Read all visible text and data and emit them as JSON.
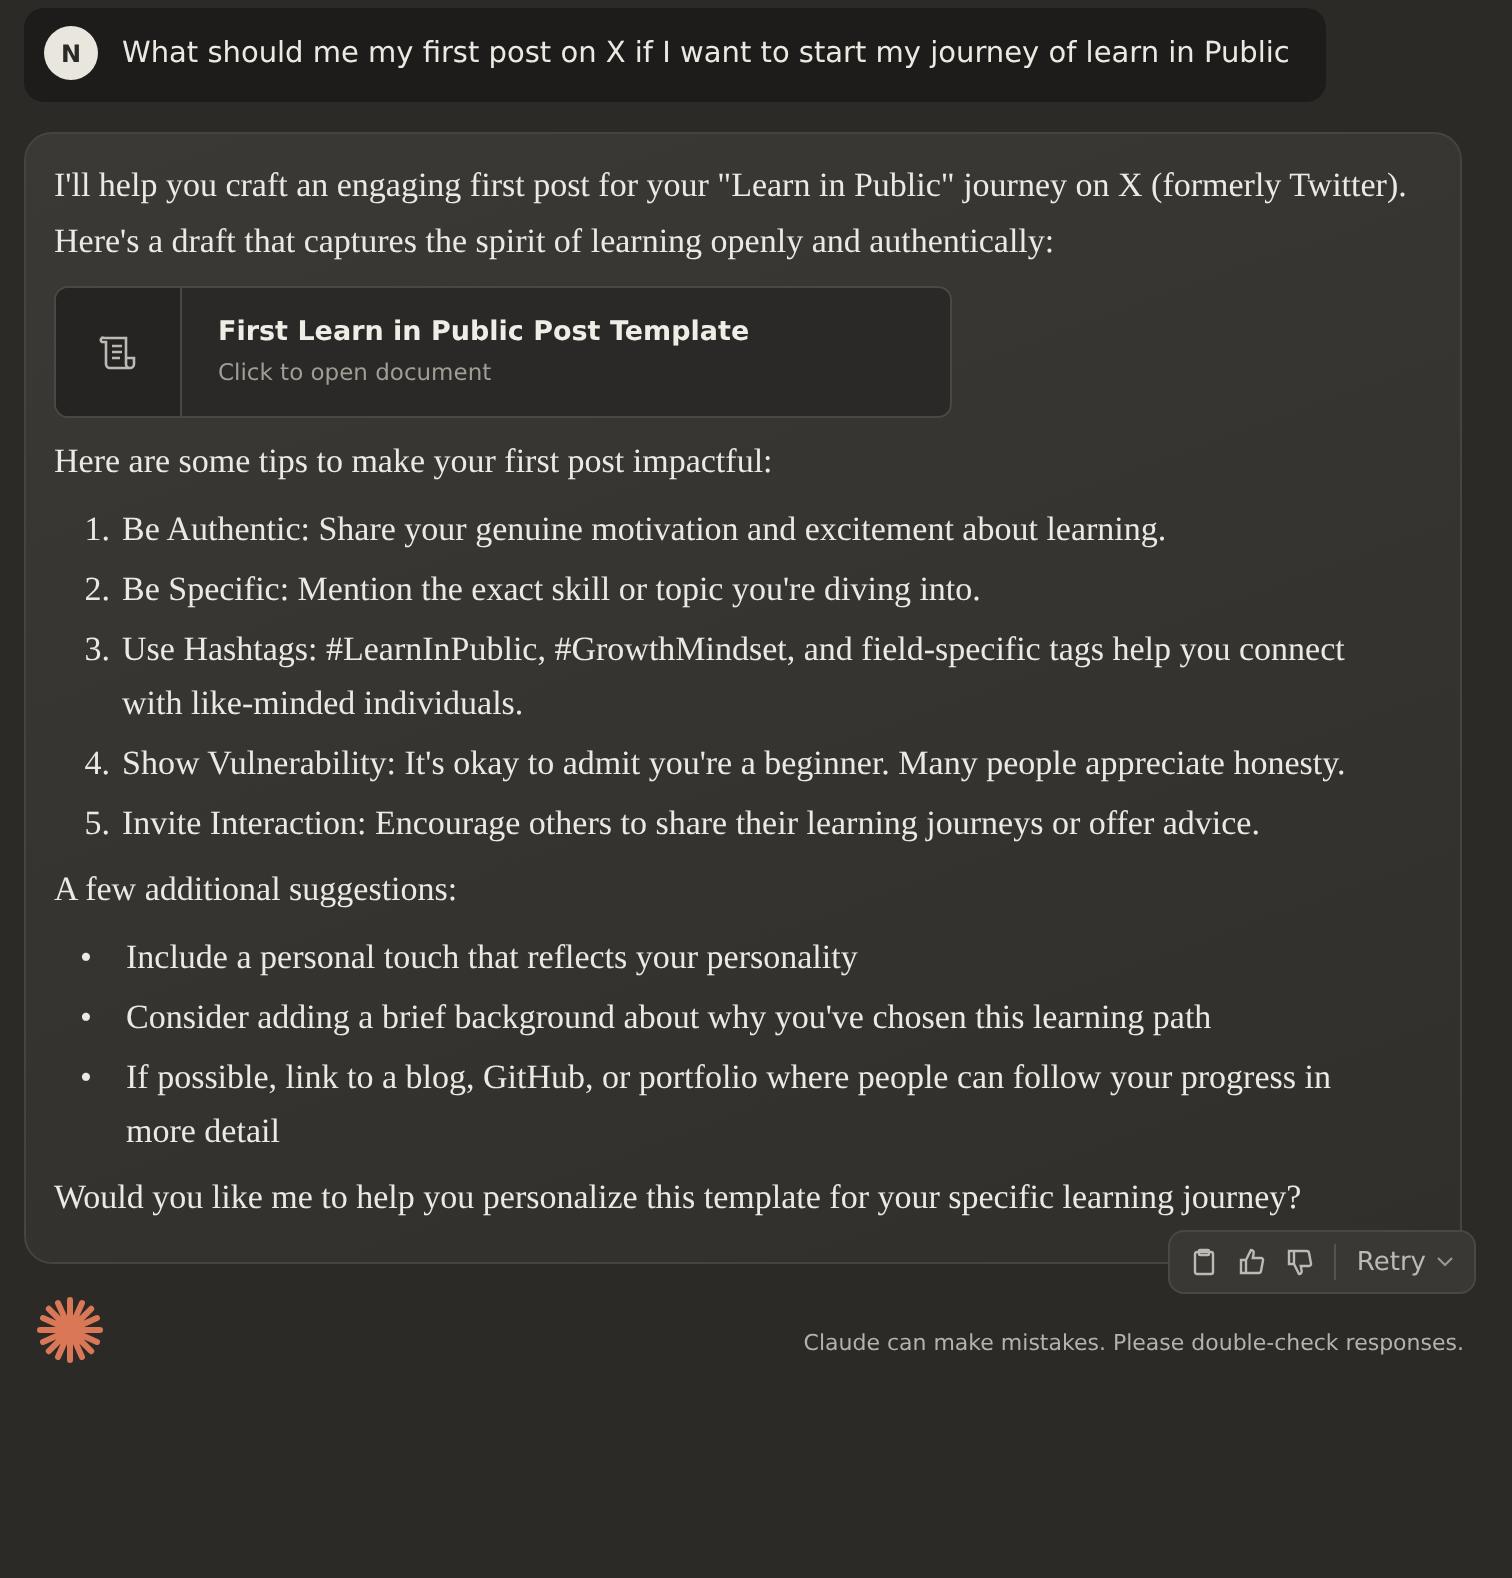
{
  "user_message": {
    "avatar": "N",
    "text": "What should me my first post on X if I want to start my journey of learn in Public"
  },
  "response": {
    "intro": "I'll help you craft an engaging first post for your \"Learn in Public\" journey on X (formerly Twitter). Here's a draft that captures the spirit of learning openly and authentically:",
    "document": {
      "title": "First Learn in Public Post Template",
      "subtitle": "Click to open document"
    },
    "tips_heading": "Here are some tips to make your first post impactful:",
    "tips": [
      {
        "marker": "1.",
        "text": "Be Authentic: Share your genuine motivation and excitement about learning."
      },
      {
        "marker": "2.",
        "text": "Be Specific: Mention the exact skill or topic you're diving into."
      },
      {
        "marker": "3.",
        "text": "Use Hashtags: #LearnInPublic, #GrowthMindset, and field-specific tags help you connect with like-minded individuals."
      },
      {
        "marker": "4.",
        "text": "Show Vulnerability: It's okay to admit you're a beginner. Many people appreciate honesty."
      },
      {
        "marker": "5.",
        "text": "Invite Interaction: Encourage others to share their learning journeys or offer advice."
      }
    ],
    "suggestions_heading": "A few additional suggestions:",
    "suggestions": [
      {
        "marker": "•",
        "text": "Include a personal touch that reflects your personality"
      },
      {
        "marker": "•",
        "text": "Consider adding a brief background about why you've chosen this learning path"
      },
      {
        "marker": "•",
        "text": "If possible, link to a blog, GitHub, or portfolio where people can follow your progress in more detail"
      }
    ],
    "closing": "Would you like me to help you personalize this template for your specific learning journey?"
  },
  "actions": {
    "retry": "Retry"
  },
  "footer": "Claude can make mistakes. Please double-check responses."
}
